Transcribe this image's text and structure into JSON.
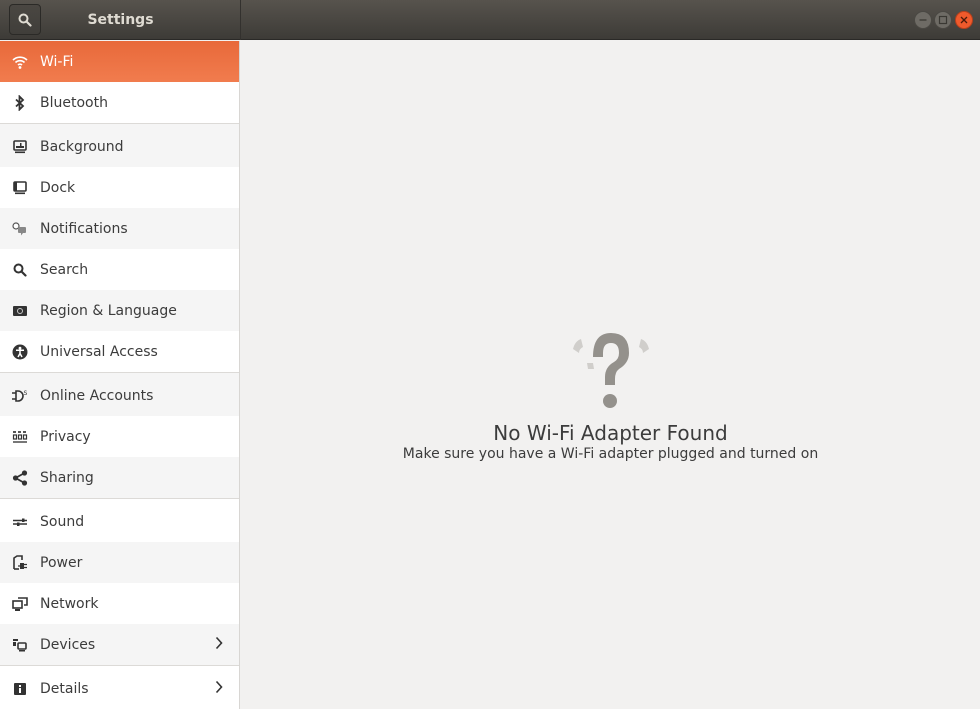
{
  "window": {
    "title": "Settings",
    "controls": {
      "minimize": "minimize",
      "maximize": "maximize",
      "close": "close"
    }
  },
  "sidebar": {
    "items": [
      {
        "label": "Wi-Fi",
        "icon": "wifi-icon",
        "active": true
      },
      {
        "label": "Bluetooth",
        "icon": "bluetooth-icon"
      },
      {
        "label": "Background",
        "icon": "background-icon"
      },
      {
        "label": "Dock",
        "icon": "dock-icon"
      },
      {
        "label": "Notifications",
        "icon": "notifications-icon"
      },
      {
        "label": "Search",
        "icon": "search-icon"
      },
      {
        "label": "Region & Language",
        "icon": "region-icon"
      },
      {
        "label": "Universal Access",
        "icon": "universal-access-icon"
      },
      {
        "label": "Online Accounts",
        "icon": "online-accounts-icon"
      },
      {
        "label": "Privacy",
        "icon": "privacy-icon"
      },
      {
        "label": "Sharing",
        "icon": "sharing-icon"
      },
      {
        "label": "Sound",
        "icon": "sound-icon"
      },
      {
        "label": "Power",
        "icon": "power-icon"
      },
      {
        "label": "Network",
        "icon": "network-icon"
      },
      {
        "label": "Devices",
        "icon": "devices-icon",
        "has_submenu": true
      },
      {
        "label": "Details",
        "icon": "details-icon",
        "has_submenu": true
      }
    ]
  },
  "main": {
    "empty_state": {
      "icon": "wifi-question-icon",
      "title": "No Wi-Fi Adapter Found",
      "subtitle": "Make sure you have a Wi-Fi adapter plugged and turned on"
    }
  },
  "colors": {
    "accent": "#ef7343",
    "titlebar": "#4a4742",
    "close": "#ef5a2c",
    "text": "#3c3c3c",
    "icon_gray": "#92908c"
  }
}
